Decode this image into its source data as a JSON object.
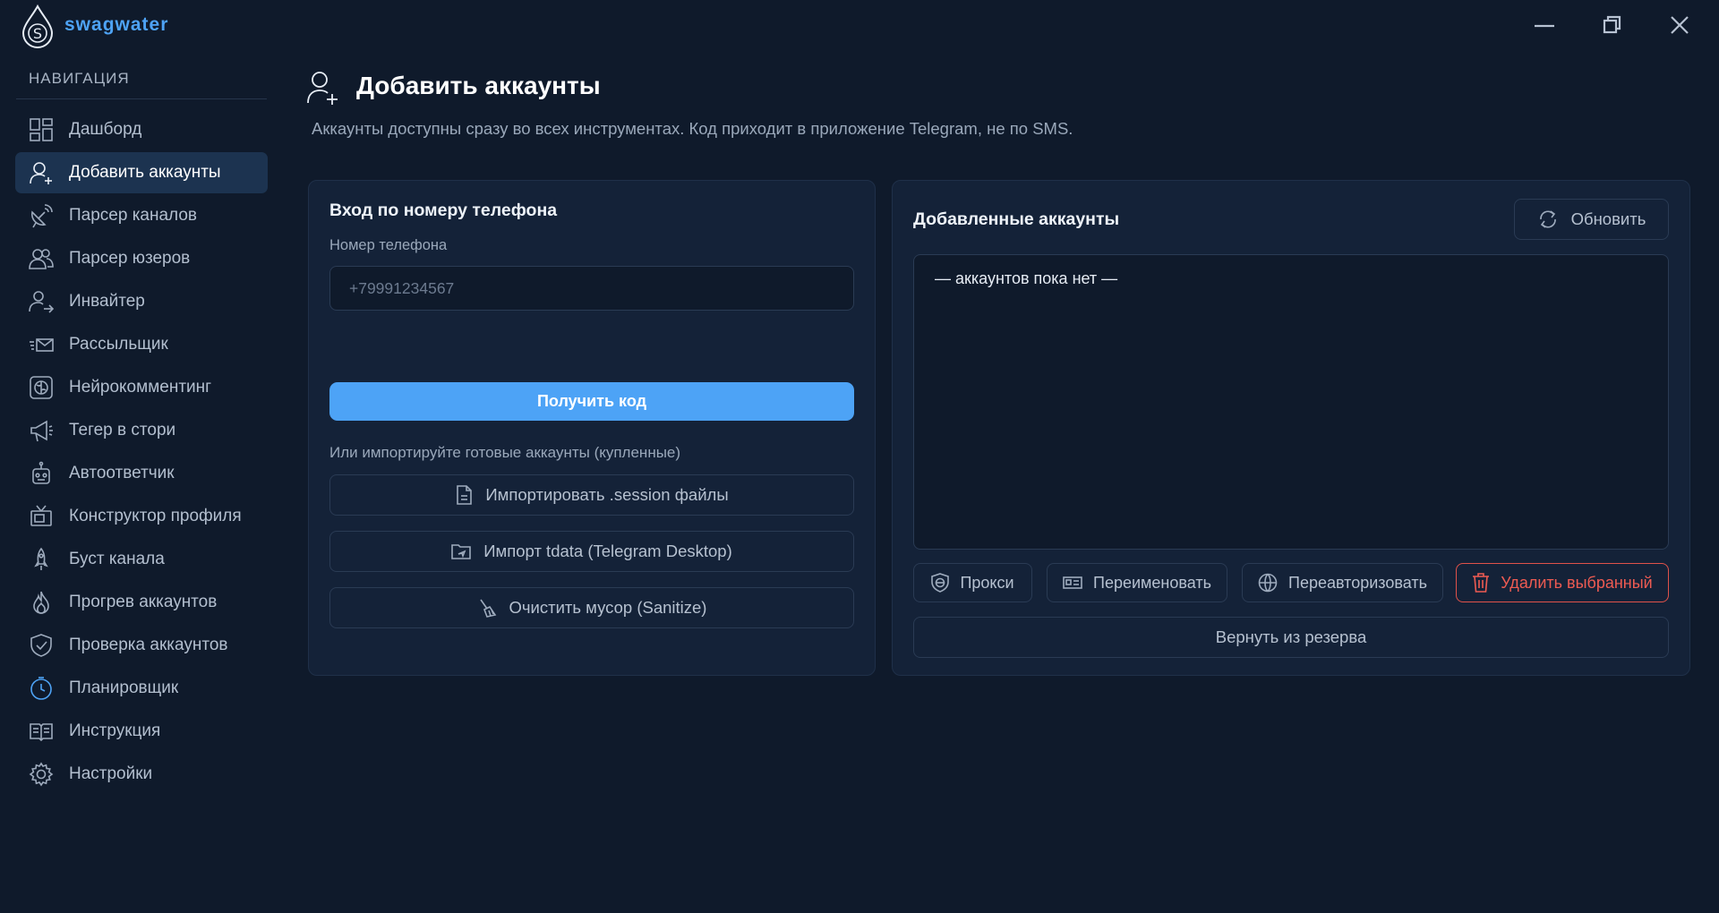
{
  "app": {
    "brand": "swagwater",
    "accent_color": "#4da3f6",
    "danger_color": "#ee5b52"
  },
  "window_controls": {
    "minimize_icon": "minimize-icon",
    "maximize_icon": "restore-icon",
    "close_icon": "close-icon"
  },
  "sidebar": {
    "title": "НАВИГАЦИЯ",
    "items": [
      {
        "label": "Дашборд",
        "icon": "dashboard-icon",
        "active": false
      },
      {
        "label": "Добавить аккаунты",
        "icon": "user-plus-icon",
        "active": true
      },
      {
        "label": "Парсер каналов",
        "icon": "satellite-icon",
        "active": false
      },
      {
        "label": "Парсер юзеров",
        "icon": "users-icon",
        "active": false
      },
      {
        "label": "Инвайтер",
        "icon": "user-arrow-icon",
        "active": false
      },
      {
        "label": "Рассыльщик",
        "icon": "envelope-send-icon",
        "active": false
      },
      {
        "label": "Нейрокомментинг",
        "icon": "brain-icon",
        "active": false
      },
      {
        "label": "Тегер в стори",
        "icon": "megaphone-icon",
        "active": false
      },
      {
        "label": "Автоответчик",
        "icon": "robot-icon",
        "active": false
      },
      {
        "label": "Конструктор профиля",
        "icon": "tv-icon",
        "active": false
      },
      {
        "label": "Буст канала",
        "icon": "rocket-icon",
        "active": false
      },
      {
        "label": "Прогрев аккаунтов",
        "icon": "flame-icon",
        "active": false
      },
      {
        "label": "Проверка аккаунтов",
        "icon": "shield-check-icon",
        "active": false
      },
      {
        "label": "Планировщик",
        "icon": "clock-icon",
        "active": false
      },
      {
        "label": "Инструкция",
        "icon": "book-icon",
        "active": false
      },
      {
        "label": "Настройки",
        "icon": "gear-icon",
        "active": false
      }
    ]
  },
  "header": {
    "title": "Добавить аккаунты",
    "subtitle": "Аккаунты доступны сразу во всех инструментах. Код приходит в приложение Telegram, не по SMS."
  },
  "login": {
    "title": "Вход по номеру телефона",
    "phone_label": "Номер телефона",
    "phone_value": "",
    "phone_placeholder": "+79991234567",
    "get_code": "Получить код",
    "import_hint": "Или импортируйте готовые аккаунты (купленные)",
    "import_session": "Импортировать .session файлы",
    "import_tdata": "Импорт tdata (Telegram Desktop)",
    "sanitize": "Очистить мусор (Sanitize)"
  },
  "accounts": {
    "title": "Добавленные аккаунты",
    "refresh": "Обновить",
    "empty": "— аккаунтов пока нет —",
    "proxy": "Прокси",
    "rename": "Переименовать",
    "reauth": "Переавторизовать",
    "delete": "Удалить выбранный",
    "restore": "Вернуть из резерва"
  }
}
